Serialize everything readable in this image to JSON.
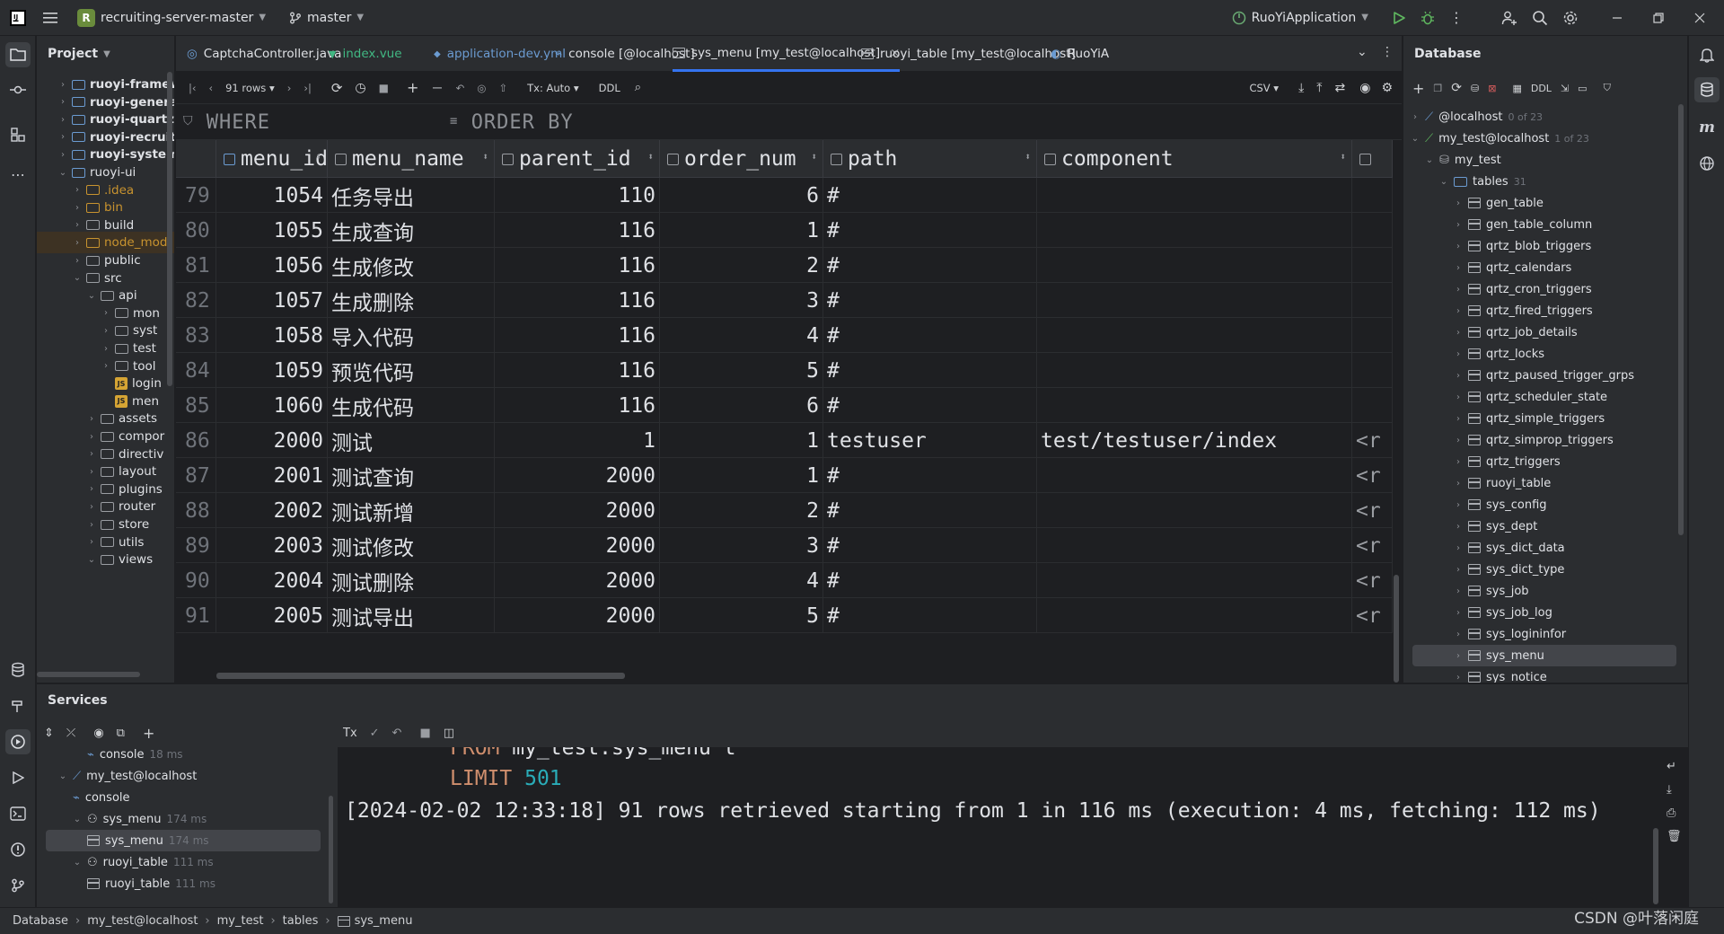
{
  "titlebar": {
    "project": "recruiting-server-master",
    "project_badge": "R",
    "branch": "master",
    "run_config": "RuoYiApplication"
  },
  "project_panel": {
    "title": "Project",
    "items": [
      {
        "label": "ruoyi-framew",
        "bold": true,
        "indent": 0,
        "expanded": false
      },
      {
        "label": "ruoyi-genera",
        "bold": true,
        "indent": 0,
        "expanded": false
      },
      {
        "label": "ruoyi-quartz",
        "bold": true,
        "indent": 0,
        "expanded": false
      },
      {
        "label": "ruoyi-recruiti",
        "bold": true,
        "indent": 0,
        "expanded": false
      },
      {
        "label": "ruoyi-system",
        "bold": true,
        "indent": 0,
        "expanded": false
      },
      {
        "label": "ruoyi-ui",
        "bold": false,
        "indent": 0,
        "expanded": true
      },
      {
        "label": ".idea",
        "indent": 1,
        "color": "orange"
      },
      {
        "label": "bin",
        "indent": 1,
        "color": "orange"
      },
      {
        "label": "build",
        "indent": 1
      },
      {
        "label": "node_mod",
        "indent": 1,
        "color": "orange"
      },
      {
        "label": "public",
        "indent": 1
      },
      {
        "label": "src",
        "indent": 1,
        "expanded": true
      },
      {
        "label": "api",
        "indent": 2,
        "expanded": true
      },
      {
        "label": "mon",
        "indent": 3
      },
      {
        "label": "syst",
        "indent": 3
      },
      {
        "label": "test",
        "indent": 3
      },
      {
        "label": "tool",
        "indent": 3
      },
      {
        "label": "login",
        "indent": 3,
        "file": true
      },
      {
        "label": "men",
        "indent": 3,
        "file": true
      },
      {
        "label": "assets",
        "indent": 2
      },
      {
        "label": "compor",
        "indent": 2
      },
      {
        "label": "directiv",
        "indent": 2
      },
      {
        "label": "layout",
        "indent": 2
      },
      {
        "label": "plugins",
        "indent": 2
      },
      {
        "label": "router",
        "indent": 2
      },
      {
        "label": "store",
        "indent": 2
      },
      {
        "label": "utils",
        "indent": 2
      },
      {
        "label": "views",
        "indent": 2,
        "expanded": true
      }
    ]
  },
  "tabs": [
    {
      "label": "CaptchaController.java",
      "icon": "java-class-icon"
    },
    {
      "label": "index.vue",
      "icon": "vue-icon",
      "color": "#41b883"
    },
    {
      "label": "application-dev.yml",
      "icon": "yaml-icon",
      "color": "#6b9bd1"
    },
    {
      "label": "console [@localhost]",
      "icon": "console-icon"
    },
    {
      "label": "sys_menu [my_test@localhost]",
      "icon": "table-icon",
      "active": true
    },
    {
      "label": "ruoyi_table [my_test@localhost]",
      "icon": "table-icon"
    },
    {
      "label": "RuoYiA",
      "icon": "run-icon"
    }
  ],
  "grid_toolbar": {
    "rows": "91 rows",
    "tx": "Tx: Auto",
    "ddl": "DDL",
    "export": "CSV"
  },
  "filter": {
    "where": "WHERE",
    "order_by": "ORDER BY"
  },
  "grid": {
    "columns": [
      "menu_id",
      "menu_name",
      "parent_id",
      "order_num",
      "path",
      "component"
    ],
    "rows": [
      {
        "rn": "79",
        "menu_id": "1054",
        "menu_name": "任务导出",
        "parent_id": "110",
        "order_num": "6",
        "path": "#",
        "component": "",
        "extra": ""
      },
      {
        "rn": "80",
        "menu_id": "1055",
        "menu_name": "生成查询",
        "parent_id": "116",
        "order_num": "1",
        "path": "#",
        "component": "",
        "extra": ""
      },
      {
        "rn": "81",
        "menu_id": "1056",
        "menu_name": "生成修改",
        "parent_id": "116",
        "order_num": "2",
        "path": "#",
        "component": "",
        "extra": ""
      },
      {
        "rn": "82",
        "menu_id": "1057",
        "menu_name": "生成删除",
        "parent_id": "116",
        "order_num": "3",
        "path": "#",
        "component": "",
        "extra": ""
      },
      {
        "rn": "83",
        "menu_id": "1058",
        "menu_name": "导入代码",
        "parent_id": "116",
        "order_num": "4",
        "path": "#",
        "component": "",
        "extra": ""
      },
      {
        "rn": "84",
        "menu_id": "1059",
        "menu_name": "预览代码",
        "parent_id": "116",
        "order_num": "5",
        "path": "#",
        "component": "",
        "extra": ""
      },
      {
        "rn": "85",
        "menu_id": "1060",
        "menu_name": "生成代码",
        "parent_id": "116",
        "order_num": "6",
        "path": "#",
        "component": "",
        "extra": ""
      },
      {
        "rn": "86",
        "menu_id": "2000",
        "menu_name": "测试",
        "parent_id": "1",
        "order_num": "1",
        "path": "testuser",
        "component": "test/testuser/index",
        "extra": "<r"
      },
      {
        "rn": "87",
        "menu_id": "2001",
        "menu_name": "测试查询",
        "parent_id": "2000",
        "order_num": "1",
        "path": "#",
        "component": "",
        "extra": "<r"
      },
      {
        "rn": "88",
        "menu_id": "2002",
        "menu_name": "测试新增",
        "parent_id": "2000",
        "order_num": "2",
        "path": "#",
        "component": "",
        "extra": "<r"
      },
      {
        "rn": "89",
        "menu_id": "2003",
        "menu_name": "测试修改",
        "parent_id": "2000",
        "order_num": "3",
        "path": "#",
        "component": "",
        "extra": "<r"
      },
      {
        "rn": "90",
        "menu_id": "2004",
        "menu_name": "测试删除",
        "parent_id": "2000",
        "order_num": "4",
        "path": "#",
        "component": "",
        "extra": "<r"
      },
      {
        "rn": "91",
        "menu_id": "2005",
        "menu_name": "测试导出",
        "parent_id": "2000",
        "order_num": "5",
        "path": "#",
        "component": "",
        "extra": "<r"
      }
    ]
  },
  "database_panel": {
    "title": "Database",
    "localhost": {
      "label": "@localhost",
      "count": "0 of 23"
    },
    "my_test_host": {
      "label": "my_test@localhost",
      "count": "1 of 23"
    },
    "schema": "my_test",
    "tables_node": {
      "label": "tables",
      "count": "31"
    },
    "tables": [
      "gen_table",
      "gen_table_column",
      "qrtz_blob_triggers",
      "qrtz_calendars",
      "qrtz_cron_triggers",
      "qrtz_fired_triggers",
      "qrtz_job_details",
      "qrtz_locks",
      "qrtz_paused_trigger_grps",
      "qrtz_scheduler_state",
      "qrtz_simple_triggers",
      "qrtz_simprop_triggers",
      "qrtz_triggers",
      "ruoyi_table",
      "sys_config",
      "sys_dept",
      "sys_dict_data",
      "sys_dict_type",
      "sys_job",
      "sys_job_log",
      "sys_logininfor",
      "sys_menu",
      "sys_notice"
    ],
    "selected": "sys_menu"
  },
  "services": {
    "title": "Services",
    "tree": [
      {
        "label": "console",
        "time": "18 ms",
        "indent": 3,
        "icon": "console-icon"
      },
      {
        "label": "my_test@localhost",
        "time": "",
        "indent": 1,
        "icon": "datasource-icon",
        "expanded": true
      },
      {
        "label": "console",
        "time": "",
        "indent": 2,
        "icon": "console-icon"
      },
      {
        "label": "sys_menu",
        "time": "174 ms",
        "indent": 2,
        "icon": "session-icon",
        "expanded": true
      },
      {
        "label": "sys_menu",
        "time": "174 ms",
        "indent": 3,
        "icon": "table-icon",
        "selected": true
      },
      {
        "label": "ruoyi_table",
        "time": "111 ms",
        "indent": 2,
        "icon": "session-icon",
        "expanded": true
      },
      {
        "label": "ruoyi_table",
        "time": "111 ms",
        "indent": 3,
        "icon": "table-icon"
      }
    ],
    "tx_label": "Tx",
    "console_lines": {
      "from_kw": "FROM",
      "from_rest": " my_test.sys_menu t",
      "limit_kw": "LIMIT",
      "limit_num": "501",
      "result": "[2024-02-02 12:33:18] 91 rows retrieved starting from 1 in 116 ms (execution: 4 ms, fetching: 112 ms)"
    }
  },
  "statusbar": {
    "crumbs": [
      "Database",
      "my_test@localhost",
      "my_test",
      "tables",
      "sys_menu"
    ],
    "watermark": "CSDN @叶落闲庭"
  }
}
